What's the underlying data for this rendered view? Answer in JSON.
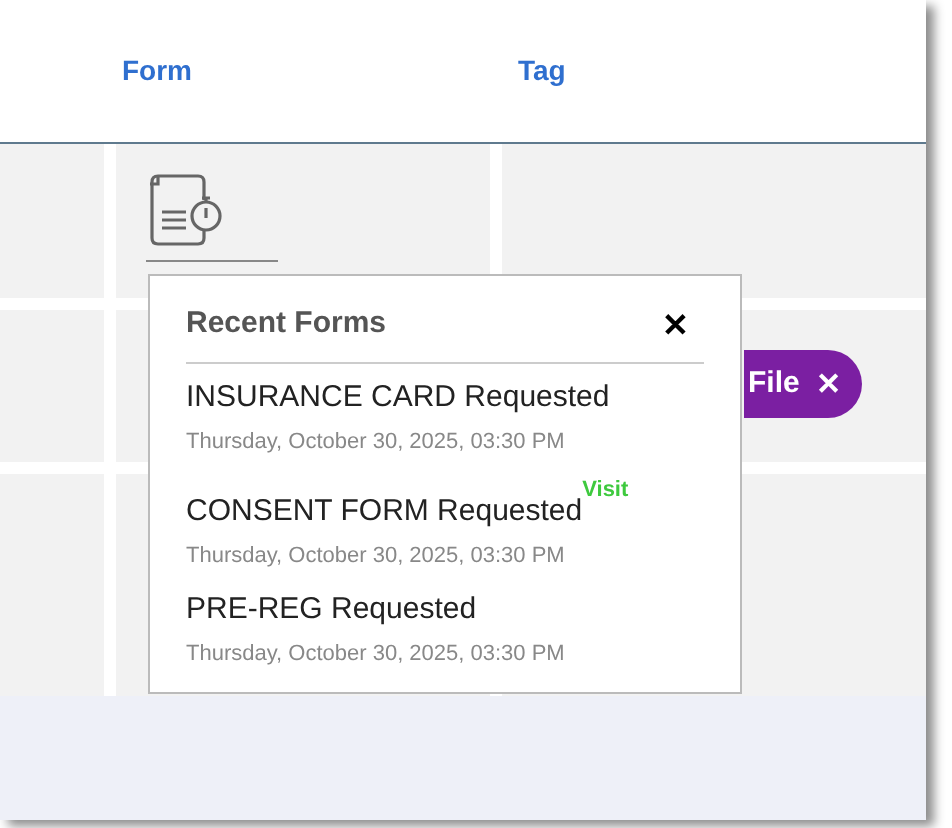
{
  "table": {
    "columns": [
      "Form",
      "Tag"
    ],
    "tag_chip": {
      "label": "File",
      "close": "✕"
    }
  },
  "popup": {
    "title": "Recent Forms",
    "close": "✕",
    "items": [
      {
        "text": "INSURANCE CARD Requested",
        "date": "Thursday, October 30, 2025, 03:30 PM"
      },
      {
        "text": "CONSENT FORM Requested",
        "badge": "Visit",
        "date": "Thursday, October 30, 2025, 03:30 PM"
      },
      {
        "text": "PRE-REG Requested",
        "date": "Thursday, October 30, 2025, 03:30 PM"
      }
    ]
  }
}
